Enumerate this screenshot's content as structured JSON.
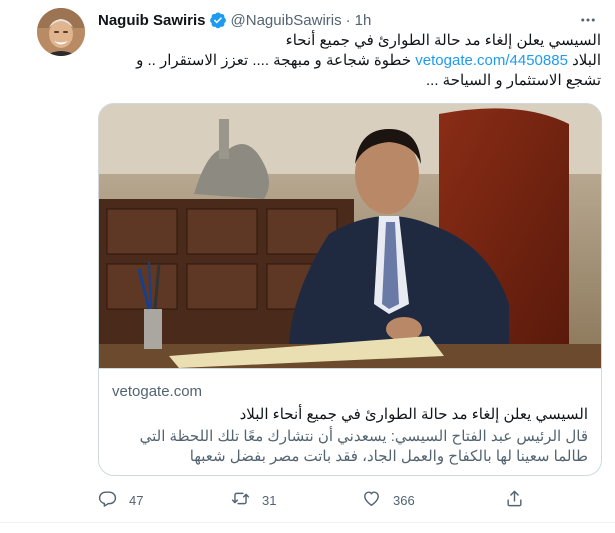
{
  "tweet": {
    "author_name": "Naguib Sawiris",
    "handle": "@NaguibSawiris",
    "separator": "·",
    "time": "1h",
    "text_line1": "السيسي يعلن إلغاء مد حالة الطوارئ في جميع أنحاء",
    "text_line2_prefix": "البلاد",
    "link": "vetogate.com/4450885",
    "text_line2_suffix": "خطوة شجاعة و مبهجة .... تعزز الاستقرار .. و",
    "text_line3": "تشجع الاستثمار و  السياحة ..."
  },
  "card": {
    "domain": "vetogate.com",
    "title": "السيسي يعلن إلغاء مد حالة الطوارئ في جميع أنحاء البلاد",
    "description": "قال الرئيس عبد الفتاح السيسي: يسعدني أن نتشارك معًا تلك اللحظة التي طالما سعينا لها بالكفاح والعمل الجاد، فقد باتت مصر بفضل شعبها"
  },
  "actions": {
    "reply_count": "47",
    "retweet_count": "31",
    "like_count": "366"
  },
  "icons": {
    "more": "more-dots-icon",
    "verified": "verified-badge-icon",
    "reply": "reply-icon",
    "retweet": "retweet-icon",
    "like": "heart-icon",
    "share": "share-icon"
  },
  "colors": {
    "link": "#1d9bf0",
    "secondary_text": "#536471",
    "primary_text": "#0f1419",
    "border": "#cfd9de"
  }
}
